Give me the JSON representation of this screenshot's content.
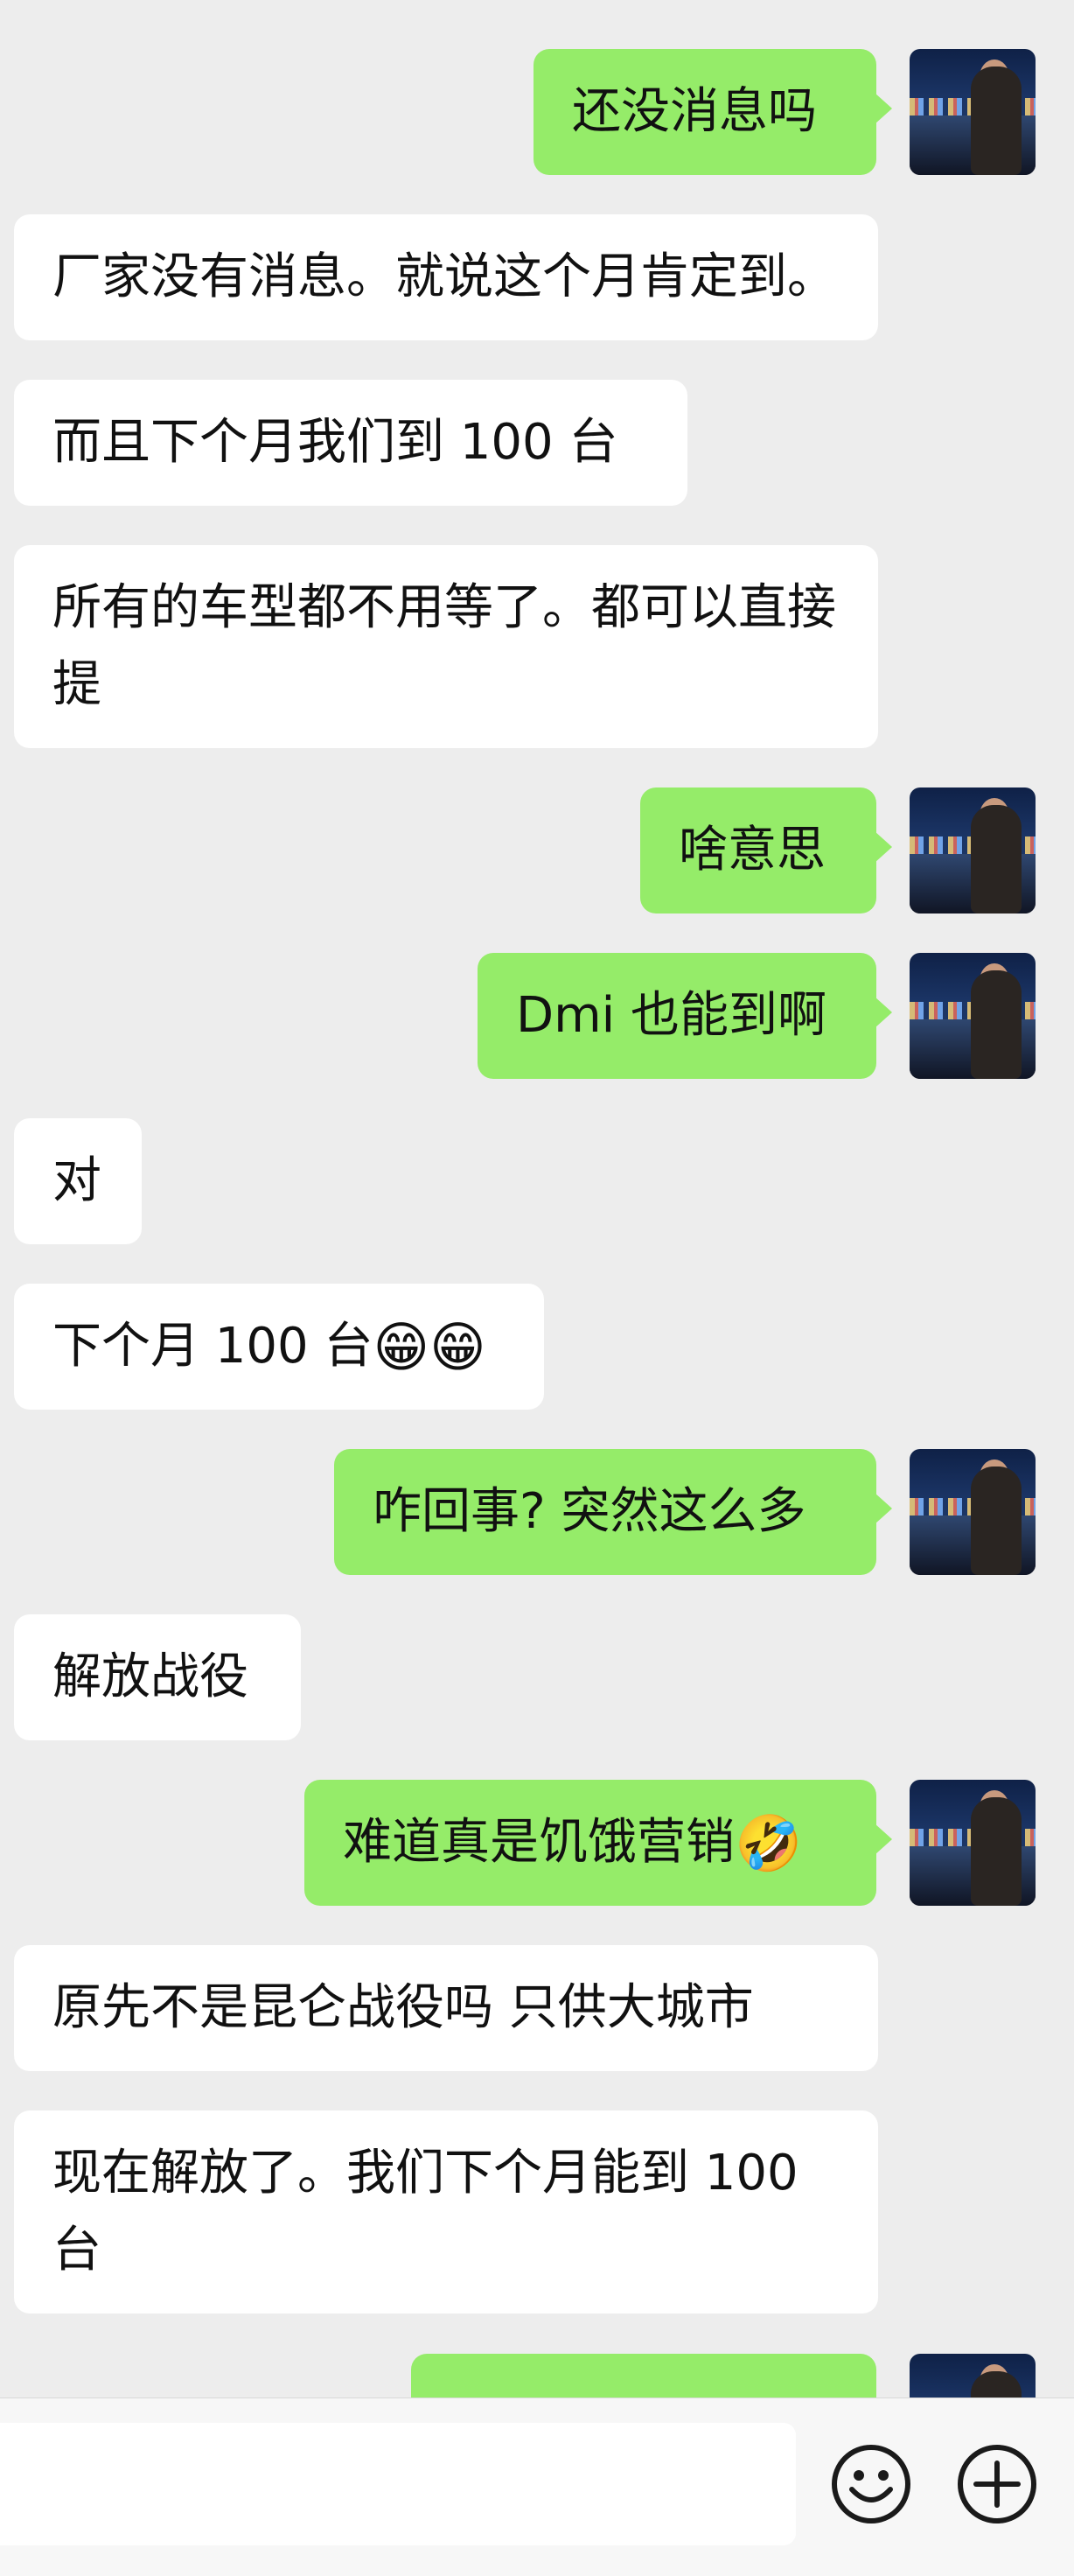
{
  "messages": [
    {
      "side": "out",
      "text": "还没消息吗"
    },
    {
      "side": "in",
      "text": "厂家没有消息。就说这个月肯定到。"
    },
    {
      "side": "in",
      "text": "而且下个月我们到 100 台"
    },
    {
      "side": "in",
      "text": "所有的车型都不用等了。都可以直接提"
    },
    {
      "side": "out",
      "text": "啥意思"
    },
    {
      "side": "out",
      "text": "Dmi 也能到啊"
    },
    {
      "side": "in",
      "text": "对"
    },
    {
      "side": "in",
      "text": "下个月 100 台",
      "emoji": "😁😁"
    },
    {
      "side": "out",
      "text": "咋回事? 突然这么多"
    },
    {
      "side": "in",
      "text": "解放战役"
    },
    {
      "side": "out",
      "text": "难道真是饥饿营销",
      "emoji": "🤣"
    },
    {
      "side": "in",
      "text": "原先不是昆仑战役吗 只供大城市"
    },
    {
      "side": "in",
      "text": "现在解放了。我们下个月能到 100 台"
    },
    {
      "side": "out",
      "text": "",
      "partial": true
    }
  ],
  "input": {
    "placeholder": "",
    "emoji_icon": "smiley-face-icon",
    "plus_icon": "plus-circle-icon"
  },
  "colors": {
    "background": "#ededed",
    "incoming_bubble": "#ffffff",
    "outgoing_bubble": "#95ec69"
  }
}
